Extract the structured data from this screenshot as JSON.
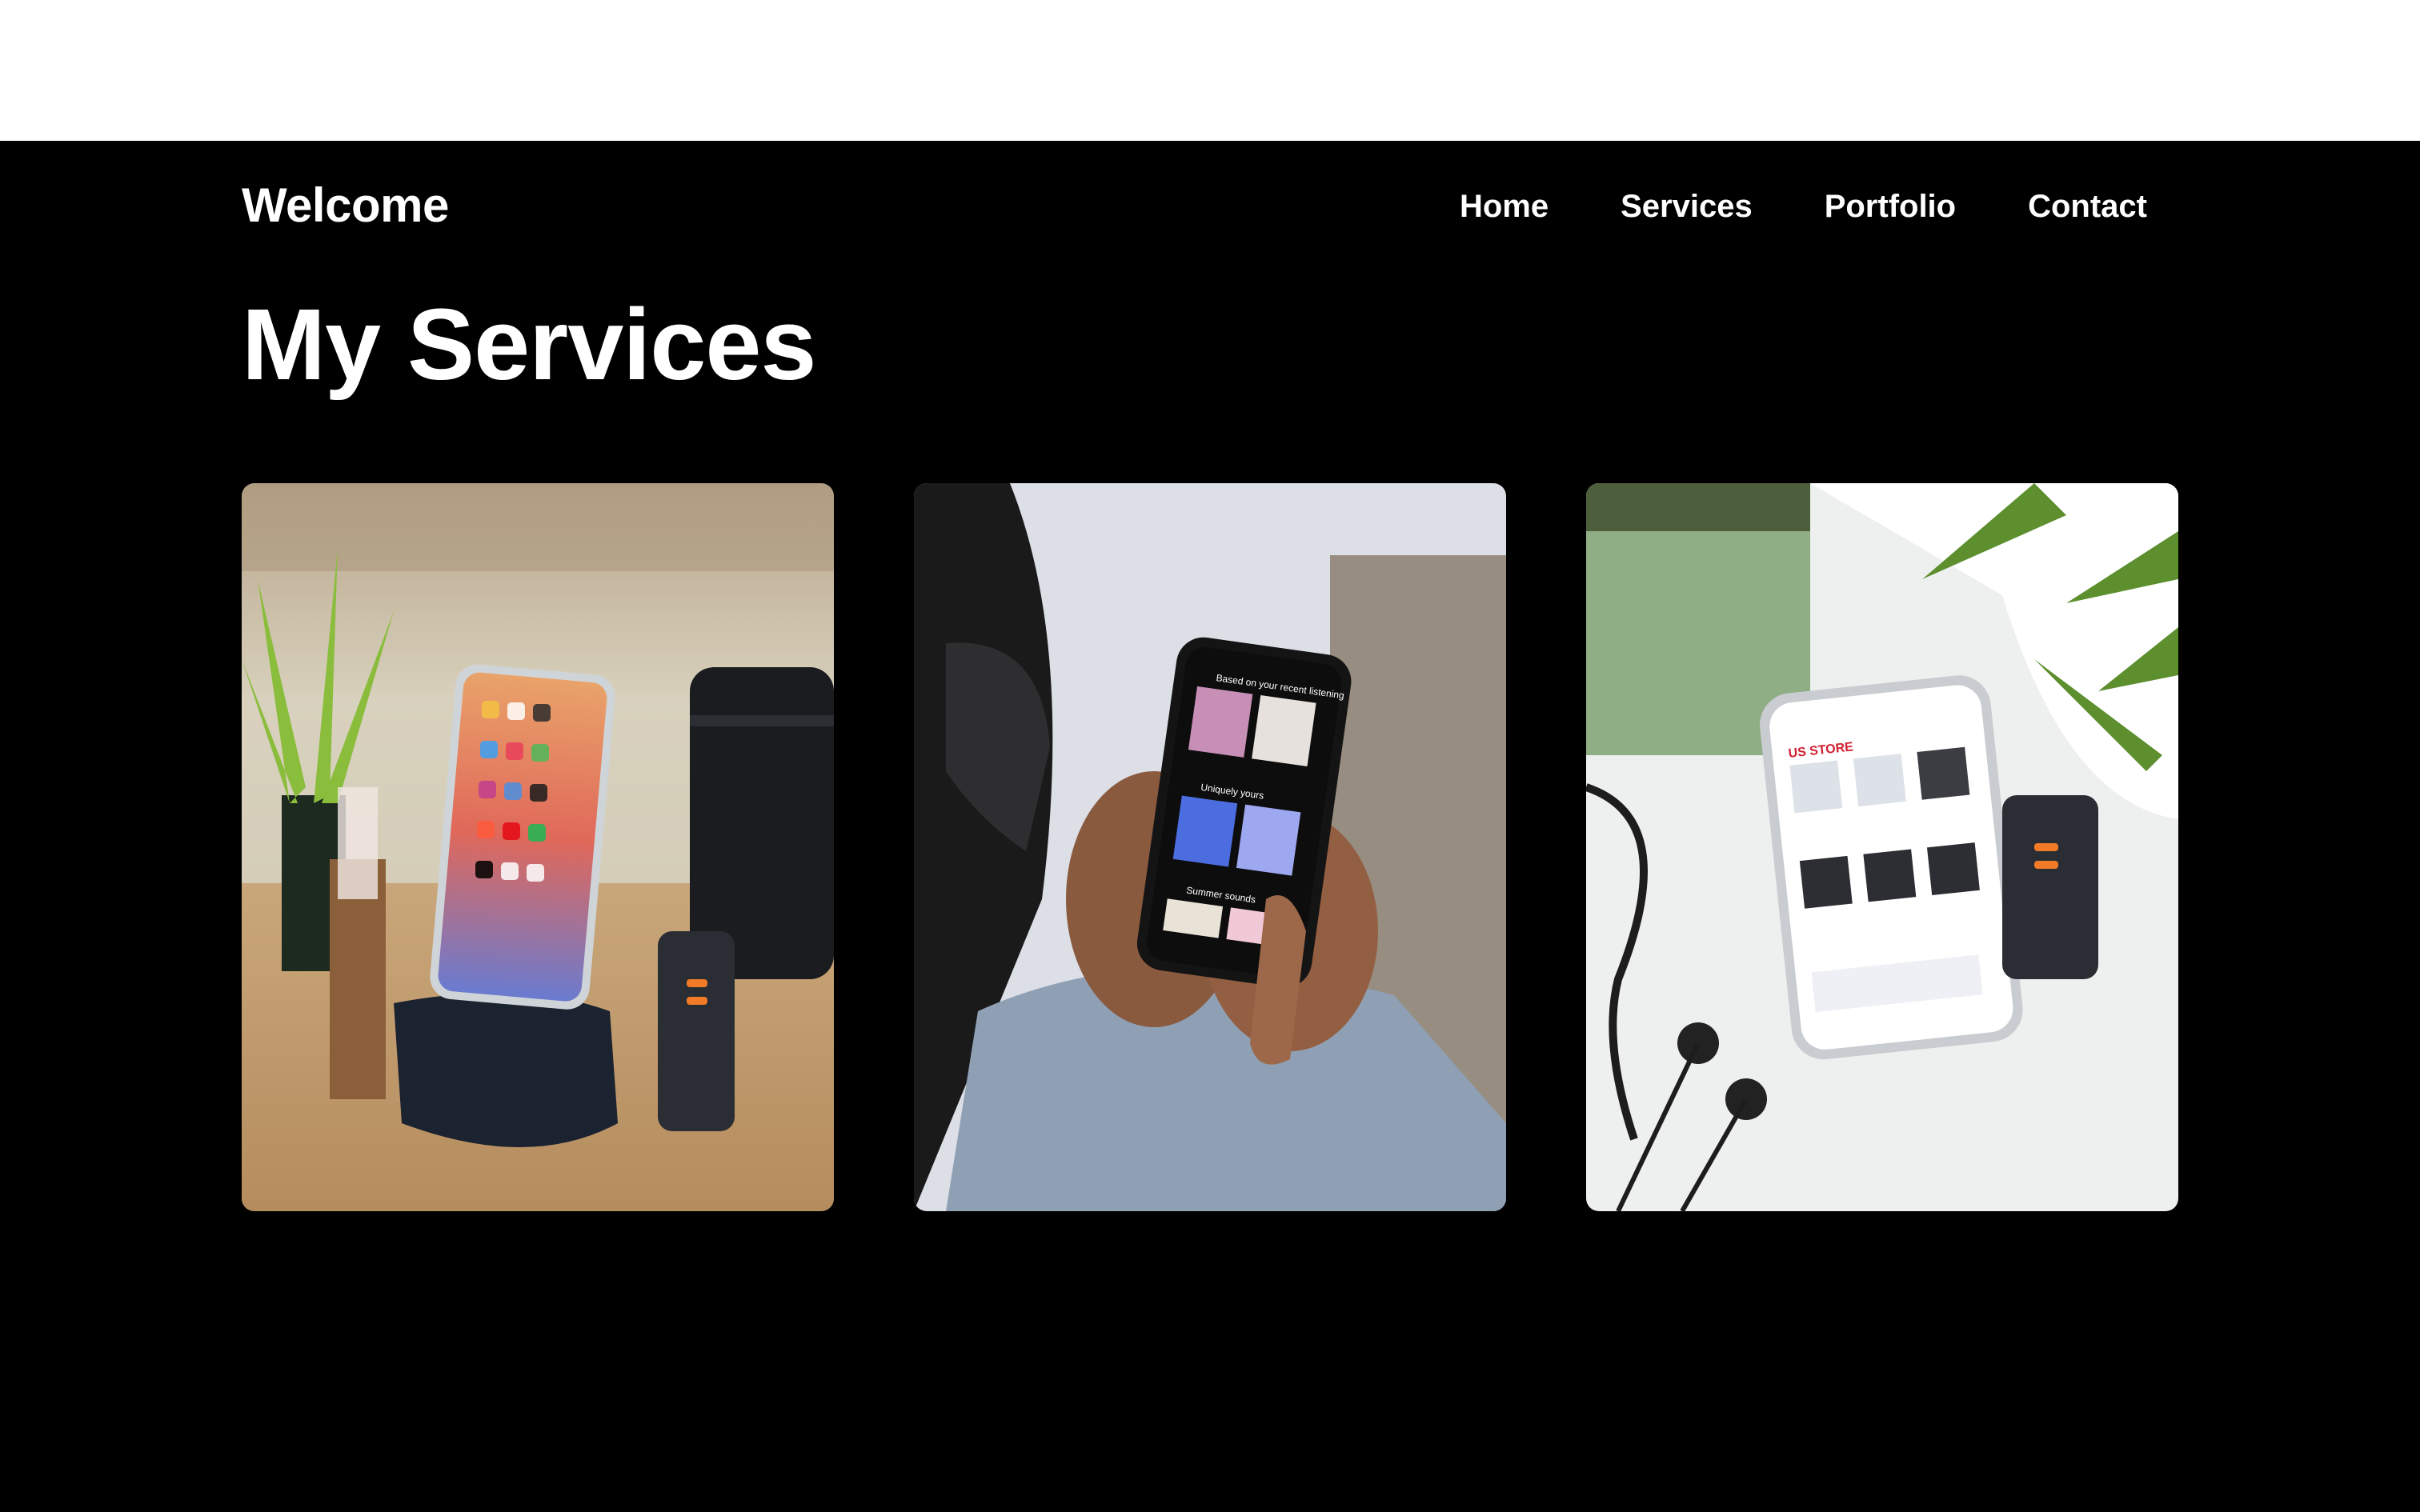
{
  "header": {
    "brand": "Welcome",
    "nav": [
      "Home",
      "Services",
      "Portfolio",
      "Contact"
    ]
  },
  "main": {
    "title": "My Services"
  },
  "cards": [
    {
      "image": "phone-on-stand-desk-photo",
      "screen_text": ""
    },
    {
      "image": "hands-holding-music-app-phone-photo",
      "screen_heading": "Based on your recent listening",
      "screen_section_1": "Uniquely yours",
      "screen_section_2": "Summer sounds"
    },
    {
      "image": "phone-store-app-flatlay-photo",
      "screen_brand": "US STORE"
    }
  ],
  "colors": {
    "background": "#000000",
    "text": "#ffffff",
    "top_band": "#ffffff"
  }
}
